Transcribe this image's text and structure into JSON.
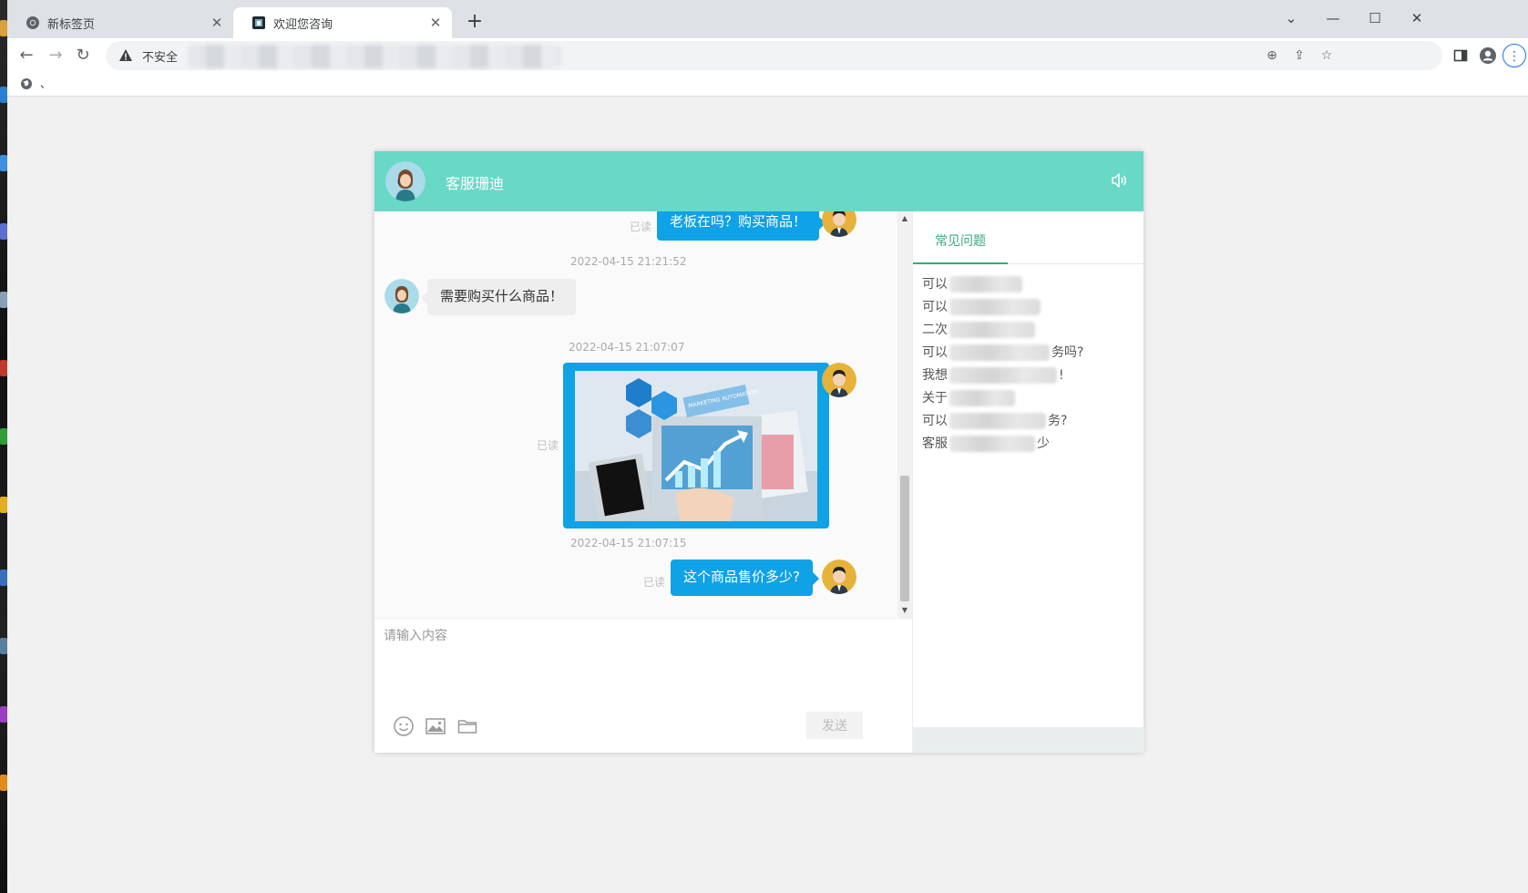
{
  "browser": {
    "tabs": [
      {
        "label": "新标签页",
        "active": false
      },
      {
        "label": "欢迎您咨询",
        "active": true
      }
    ],
    "new_tab": "+",
    "omnibox": {
      "security_label": "不安全"
    },
    "bookmark": {
      "label": "、"
    }
  },
  "chat": {
    "header": {
      "agent_name": "客服珊迪"
    },
    "messages": {
      "m1": {
        "text": "老板在吗？购买商品！",
        "read": "已读"
      },
      "ts2": "2022-04-15 21:21:52",
      "m2": {
        "text": "需要购买什么商品！"
      },
      "ts3": "2022-04-15 21:07:07",
      "m3": {
        "read": "已读",
        "image_text": "MARKETING AUTOMATION"
      },
      "ts4": "2022-04-15 21:07:15",
      "m4": {
        "text": "这个商品售价多少?",
        "read": "已读"
      }
    },
    "input": {
      "placeholder": "请输入内容",
      "value": ""
    },
    "send_label": "发送",
    "sidebar": {
      "tab_label": "常见问题",
      "faq": [
        {
          "prefix": "可以",
          "suffix": ""
        },
        {
          "prefix": "可以",
          "suffix": ""
        },
        {
          "prefix": "二次",
          "suffix": ""
        },
        {
          "prefix": "可以",
          "suffix": "务吗?"
        },
        {
          "prefix": "我想",
          "suffix": "!"
        },
        {
          "prefix": "关于",
          "suffix": ""
        },
        {
          "prefix": "可以",
          "suffix": "务?"
        },
        {
          "prefix": "客服",
          "suffix": "少"
        }
      ]
    }
  },
  "colors": {
    "header": "#69d8c6",
    "my_bubble": "#0fa2e6",
    "their_bubble": "#eeeeee",
    "accent_tab": "#3aa87c"
  }
}
